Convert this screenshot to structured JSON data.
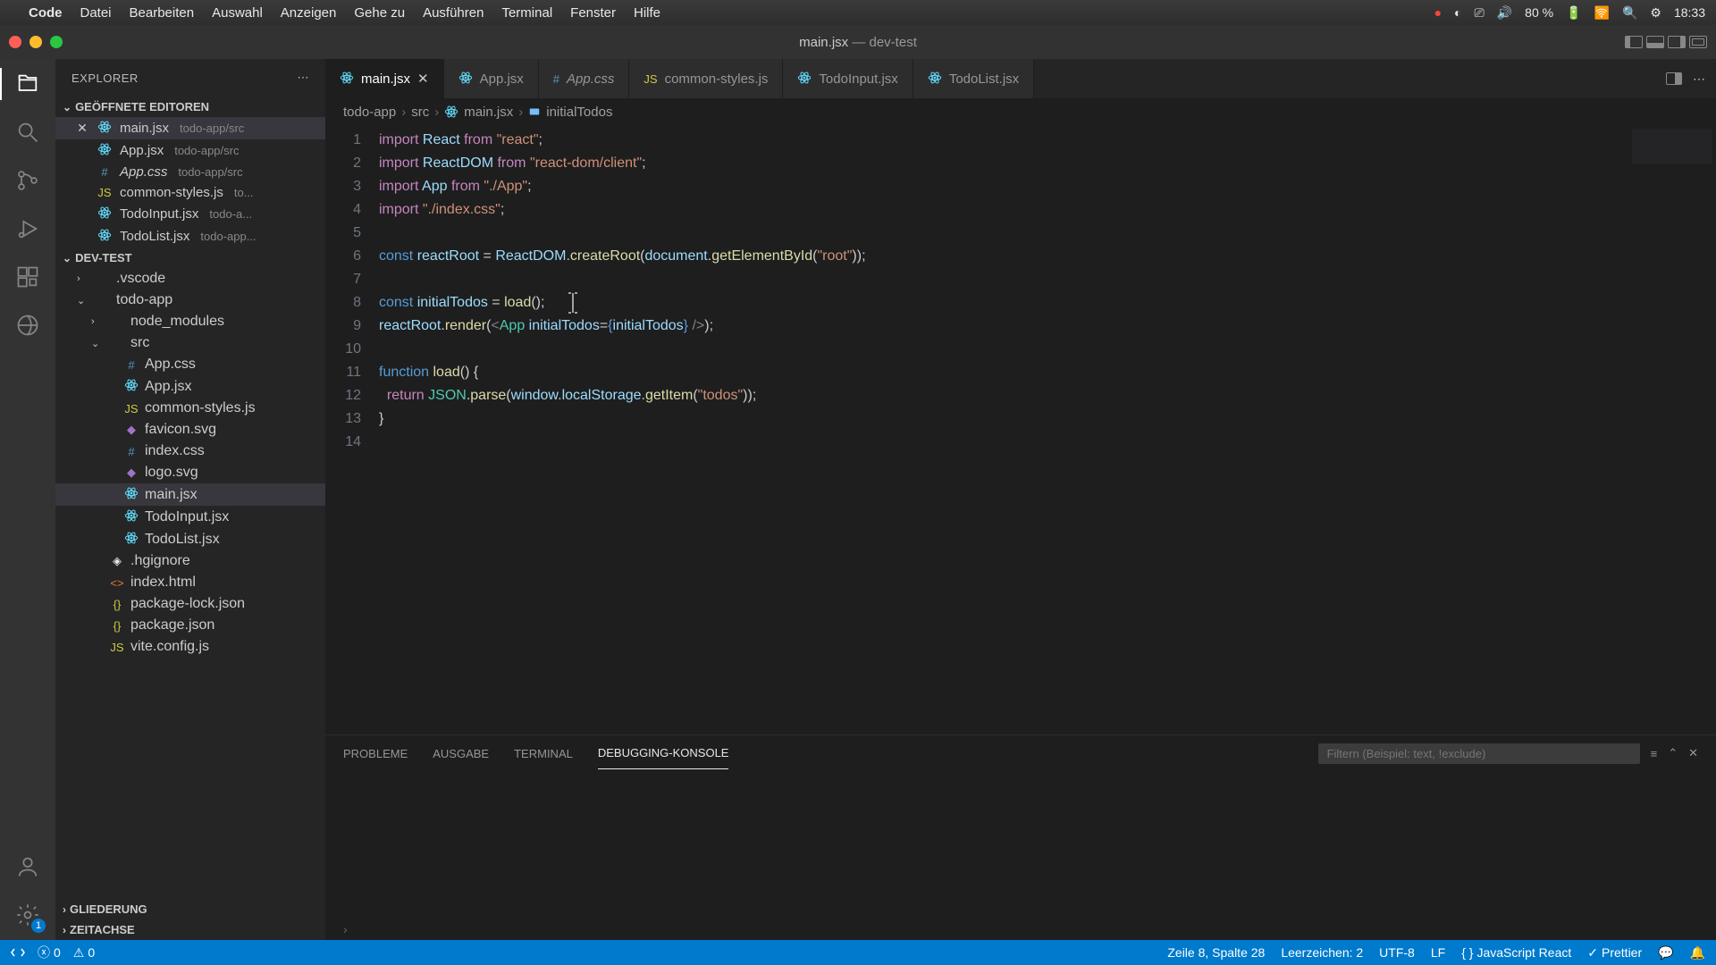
{
  "menubar": {
    "app": "Code",
    "items": [
      "Datei",
      "Bearbeiten",
      "Auswahl",
      "Anzeigen",
      "Gehe zu",
      "Ausführen",
      "Terminal",
      "Fenster",
      "Hilfe"
    ],
    "battery": "80 %",
    "time": "18:33",
    "date_icon": "📅"
  },
  "window": {
    "title": "main.jsx",
    "project": "dev-test"
  },
  "explorer": {
    "title": "EXPLORER",
    "open_editors": "GEÖFFNETE EDITOREN",
    "workspace": "DEV-TEST",
    "gliederung": "GLIEDERUNG",
    "zeitachse": "ZEITACHSE",
    "open": [
      {
        "name": "main.jsx",
        "path": "todo-app/src",
        "icon": "react",
        "active": true,
        "dirty": false
      },
      {
        "name": "App.jsx",
        "path": "todo-app/src",
        "icon": "react"
      },
      {
        "name": "App.css",
        "path": "todo-app/src",
        "icon": "css",
        "italic": true
      },
      {
        "name": "common-styles.js",
        "path": "to...",
        "icon": "js"
      },
      {
        "name": "TodoInput.jsx",
        "path": "todo-a...",
        "icon": "react"
      },
      {
        "name": "TodoList.jsx",
        "path": "todo-app...",
        "icon": "react"
      }
    ],
    "tree": [
      {
        "name": ".vscode",
        "type": "folder",
        "ind": 1,
        "open": false
      },
      {
        "name": "todo-app",
        "type": "folder",
        "ind": 1,
        "open": true
      },
      {
        "name": "node_modules",
        "type": "folder",
        "ind": 2,
        "open": false
      },
      {
        "name": "src",
        "type": "folder",
        "ind": 2,
        "open": true
      },
      {
        "name": "App.css",
        "type": "file",
        "ind": 3,
        "icon": "css"
      },
      {
        "name": "App.jsx",
        "type": "file",
        "ind": 3,
        "icon": "react"
      },
      {
        "name": "common-styles.js",
        "type": "file",
        "ind": 3,
        "icon": "js"
      },
      {
        "name": "favicon.svg",
        "type": "file",
        "ind": 3,
        "icon": "svg"
      },
      {
        "name": "index.css",
        "type": "file",
        "ind": 3,
        "icon": "css"
      },
      {
        "name": "logo.svg",
        "type": "file",
        "ind": 3,
        "icon": "svg"
      },
      {
        "name": "main.jsx",
        "type": "file",
        "ind": 3,
        "icon": "react",
        "sel": true
      },
      {
        "name": "TodoInput.jsx",
        "type": "file",
        "ind": 3,
        "icon": "react"
      },
      {
        "name": "TodoList.jsx",
        "type": "file",
        "ind": 3,
        "icon": "react"
      },
      {
        "name": ".hgignore",
        "type": "file",
        "ind": 2,
        "icon": "git"
      },
      {
        "name": "index.html",
        "type": "file",
        "ind": 2,
        "icon": "html"
      },
      {
        "name": "package-lock.json",
        "type": "file",
        "ind": 2,
        "icon": "json"
      },
      {
        "name": "package.json",
        "type": "file",
        "ind": 2,
        "icon": "json"
      },
      {
        "name": "vite.config.js",
        "type": "file",
        "ind": 2,
        "icon": "js"
      }
    ]
  },
  "tabs": [
    {
      "name": "main.jsx",
      "icon": "react",
      "active": true,
      "close": true
    },
    {
      "name": "App.jsx",
      "icon": "react"
    },
    {
      "name": "App.css",
      "icon": "css",
      "italic": true
    },
    {
      "name": "common-styles.js",
      "icon": "js"
    },
    {
      "name": "TodoInput.jsx",
      "icon": "react"
    },
    {
      "name": "TodoList.jsx",
      "icon": "react"
    }
  ],
  "breadcrumb": [
    "todo-app",
    "src",
    "main.jsx",
    "initialTodos"
  ],
  "code_lines": [
    1,
    2,
    3,
    4,
    5,
    6,
    7,
    8,
    9,
    10,
    11,
    12,
    13,
    14
  ],
  "panel": {
    "tabs": [
      "PROBLEME",
      "AUSGABE",
      "TERMINAL",
      "DEBUGGING-KONSOLE"
    ],
    "active": 3,
    "filter_placeholder": "Filtern (Beispiel: text, !exclude)"
  },
  "status": {
    "errors": "0",
    "warnings": "0",
    "cursor": "Zeile 8, Spalte 28",
    "indent": "Leerzeichen: 2",
    "encoding": "UTF-8",
    "eol": "LF",
    "lang": "JavaScript React",
    "prettier": "Prettier"
  },
  "settings_badge": "1"
}
